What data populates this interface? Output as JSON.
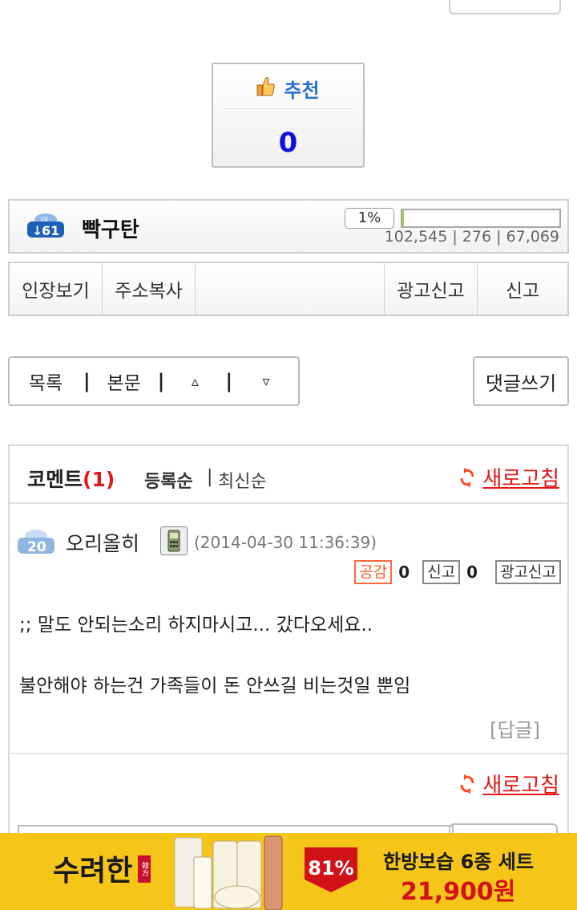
{
  "recommend": {
    "label": "추천",
    "count": "0"
  },
  "author": {
    "level": "61",
    "level_prefix": "LV",
    "name": "빡구탄",
    "exp_percent": "1%",
    "exp_fraction": 0.01,
    "stats": "102,545 | 276 | 67,069"
  },
  "actions": [
    "인장보기",
    "주소복사",
    "",
    "광고신고",
    "신고"
  ],
  "nav": {
    "list": "목록",
    "body": "본문",
    "up": "▵",
    "down": "▿",
    "sep": "|",
    "write": "댓글쓰기"
  },
  "comments": {
    "title": "코멘트",
    "count": "(1)",
    "sort_registered": "등록순",
    "sort_sep": "|",
    "sort_latest": "최신순",
    "refresh_label": "새로고침",
    "items": [
      {
        "level": "20",
        "author": "오리올히",
        "date": "(2014-04-30 11:36:39)",
        "like_label": "공감",
        "like_count": "0",
        "report_label": "신고",
        "report_count": "0",
        "ad_report_label": "광고신고",
        "lines": [
          ";; 말도 안되는소리 하지마시고... 갔다오세요..",
          "",
          "불안해야 하는건 가족들이 돈 안쓰길 비는것일 뿐임"
        ],
        "reply_label": "[답글]"
      }
    ]
  },
  "ad": {
    "brand": "수려한",
    "brand_tag": "韓方",
    "discount": "81%",
    "title": "한방보습 6종 세트",
    "price": "21,900원"
  },
  "colors": {
    "accent_red": "#e01818",
    "count_blue": "#1010e0",
    "ad_yellow": "#f5c518"
  }
}
